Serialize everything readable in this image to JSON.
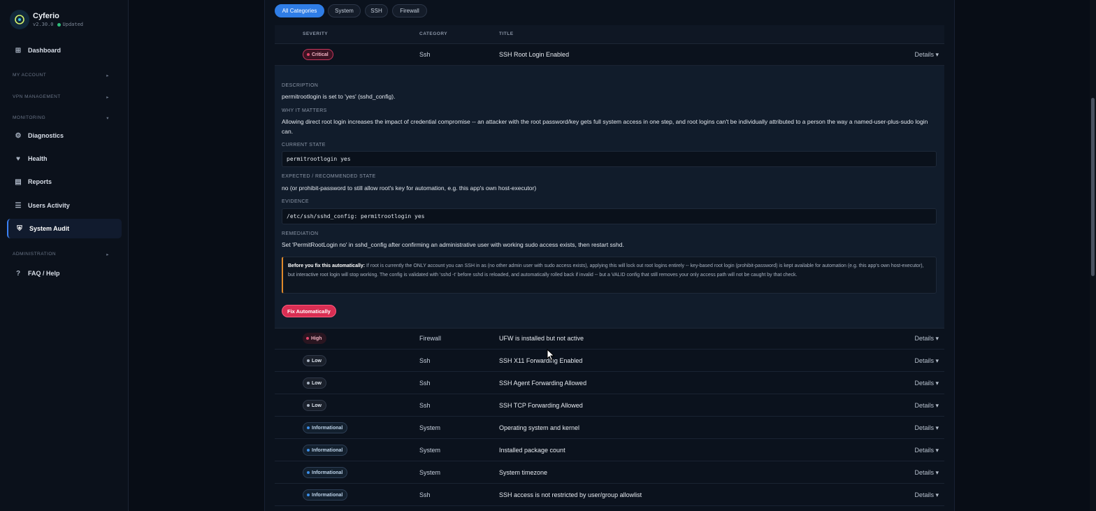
{
  "brand": {
    "name": "Cyferio",
    "version": "v2.30.0",
    "status": "Updated"
  },
  "sidebar": {
    "items": [
      {
        "label": "Dashboard",
        "icon": "grid-icon"
      },
      {
        "label": "Diagnostics",
        "icon": "gear-icon"
      },
      {
        "label": "Health",
        "icon": "heart-icon"
      },
      {
        "label": "Reports",
        "icon": "report-icon"
      },
      {
        "label": "Users Activity",
        "icon": "list-icon"
      },
      {
        "label": "System Audit",
        "icon": "shield-icon",
        "active": true
      },
      {
        "label": "FAQ / Help",
        "icon": "question-icon"
      }
    ],
    "sections": [
      "MY ACCOUNT",
      "VPN MANAGEMENT",
      "MONITORING",
      "ADMINISTRATION"
    ]
  },
  "filters": [
    "All Categories",
    "System",
    "SSH",
    "Firewall"
  ],
  "table": {
    "headers": [
      "SEVERITY",
      "CATEGORY",
      "TITLE"
    ],
    "details_label": "Details ▾",
    "expanded_row": {
      "severity": "Critical",
      "category": "Ssh",
      "title": "SSH Root Login Enabled"
    },
    "rows": [
      {
        "severity": "High",
        "category": "Firewall",
        "title": "UFW is installed but not active"
      },
      {
        "severity": "Low",
        "category": "Ssh",
        "title": "SSH X11 Forwarding Enabled"
      },
      {
        "severity": "Low",
        "category": "Ssh",
        "title": "SSH Agent Forwarding Allowed"
      },
      {
        "severity": "Low",
        "category": "Ssh",
        "title": "SSH TCP Forwarding Allowed"
      },
      {
        "severity": "Informational",
        "category": "System",
        "title": "Operating system and kernel"
      },
      {
        "severity": "Informational",
        "category": "System",
        "title": "Installed package count"
      },
      {
        "severity": "Informational",
        "category": "System",
        "title": "System timezone"
      },
      {
        "severity": "Informational",
        "category": "Ssh",
        "title": "SSH access is not restricted by user/group allowlist"
      }
    ]
  },
  "detail": {
    "description_label": "DESCRIPTION",
    "description": "permitrootlogin is set to 'yes' (sshd_config).",
    "why_label": "WHY IT MATTERS",
    "why": "Allowing direct root login increases the impact of credential compromise -- an attacker with the root password/key gets full system access in one step, and root logins can't be individually attributed to a person the way a named-user-plus-sudo login can.",
    "current_label": "CURRENT STATE",
    "current": "permitrootlogin yes",
    "expected_label": "EXPECTED / RECOMMENDED STATE",
    "expected": "no (or prohibit-password to still allow root's key for automation, e.g. this app's own host-executor)",
    "evidence_label": "EVIDENCE",
    "evidence": "/etc/ssh/sshd_config: permitrootlogin yes",
    "remediation_label": "REMEDIATION",
    "remediation": "Set 'PermitRootLogin no' in sshd_config after confirming an administrative user with working sudo access exists, then restart sshd.",
    "warning_title": "Before you fix this automatically:",
    "warning": "If root is currently the ONLY account you can SSH in as (no other admin user with sudo access exists), applying this will lock out root logins entirely -- key-based root login (prohibit-password) is kept available for automation (e.g. this app's own host-executor), but interactive root login will stop working. The config is validated with 'sshd -t' before sshd is reloaded, and automatically rolled back if invalid -- but a VALID config that still removes your only access path will not be caught by that check.",
    "fix_button": "Fix Automatically"
  }
}
